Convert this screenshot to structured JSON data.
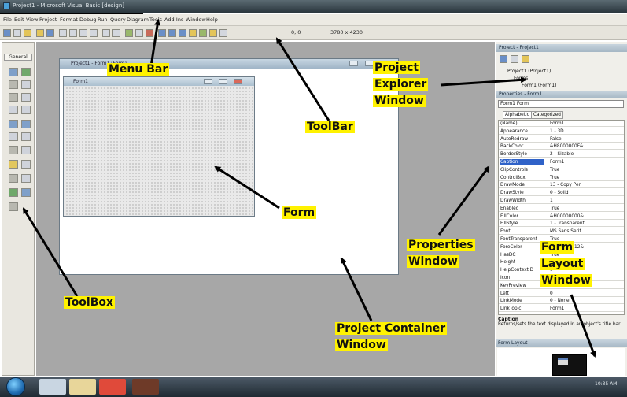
{
  "title_bar": {
    "title": "Project1 - Microsoft Visual Basic [design]"
  },
  "menu": {
    "items": [
      "File",
      "Edit",
      "View",
      "Project",
      "Format",
      "Debug",
      "Run",
      "Query",
      "Diagram",
      "Tools",
      "Add-Ins",
      "Window",
      "Help"
    ]
  },
  "toolbar": {
    "position_readout": "0, 0",
    "size_readout": "3780 x 4230"
  },
  "toolbox": {
    "header": "General"
  },
  "designer": {
    "caption": "Project1 - Form1 (Form)"
  },
  "form": {
    "caption": "Form1"
  },
  "project_explorer": {
    "title": "Project - Project1",
    "tree": [
      "Project1 (Project1)",
      "Forms",
      "Form1 (Form1)"
    ]
  },
  "properties": {
    "title": "Properties - Form1",
    "object_select": "Form1 Form",
    "tabs": [
      "Alphabetic",
      "Categorized"
    ],
    "rows": [
      {
        "name": "(Name)",
        "value": "Form1"
      },
      {
        "name": "Appearance",
        "value": "1 - 3D"
      },
      {
        "name": "AutoRedraw",
        "value": "False"
      },
      {
        "name": "BackColor",
        "value": "&H8000000F&"
      },
      {
        "name": "BorderStyle",
        "value": "2 - Sizable"
      },
      {
        "name": "Caption",
        "value": "Form1"
      },
      {
        "name": "ClipControls",
        "value": "True"
      },
      {
        "name": "ControlBox",
        "value": "True"
      },
      {
        "name": "DrawMode",
        "value": "13 - Copy Pen"
      },
      {
        "name": "DrawStyle",
        "value": "0 - Solid"
      },
      {
        "name": "DrawWidth",
        "value": "1"
      },
      {
        "name": "Enabled",
        "value": "True"
      },
      {
        "name": "FillColor",
        "value": "&H00000000&"
      },
      {
        "name": "FillStyle",
        "value": "1 - Transparent"
      },
      {
        "name": "Font",
        "value": "MS Sans Serif"
      },
      {
        "name": "FontTransparent",
        "value": "True"
      },
      {
        "name": "ForeColor",
        "value": "&H80000012&"
      },
      {
        "name": "HasDC",
        "value": "True"
      },
      {
        "name": "Height",
        "value": "3600"
      },
      {
        "name": "HelpContextID",
        "value": "0"
      },
      {
        "name": "Icon",
        "value": "(Icon)"
      },
      {
        "name": "KeyPreview",
        "value": "False"
      },
      {
        "name": "Left",
        "value": "0"
      },
      {
        "name": "LinkMode",
        "value": "0 - None"
      },
      {
        "name": "LinkTopic",
        "value": "Form1"
      }
    ],
    "caption_info_title": "Caption",
    "caption_info_text": "Returns/sets the text displayed in an object's title bar"
  },
  "form_layout": {
    "title": "Form Layout"
  },
  "taskbar": {
    "time": "10:35 AM"
  },
  "annotations": {
    "menu_bar": "Menu Bar",
    "toolbar": "ToolBar",
    "project_explorer_1": "Project",
    "project_explorer_2": "Explorer",
    "project_explorer_3": "Window",
    "form": "Form",
    "properties_1": "Properties",
    "properties_2": "Window",
    "form_layout_1": "Form",
    "form_layout_2": "Layout",
    "form_layout_3": "Window",
    "toolbox": "ToolBox",
    "container_1": "Project Container",
    "container_2": "Window"
  },
  "colors": {
    "annotation_bg": "#fff200",
    "selection": "#2f62c8",
    "container": "#a7a7a7"
  }
}
